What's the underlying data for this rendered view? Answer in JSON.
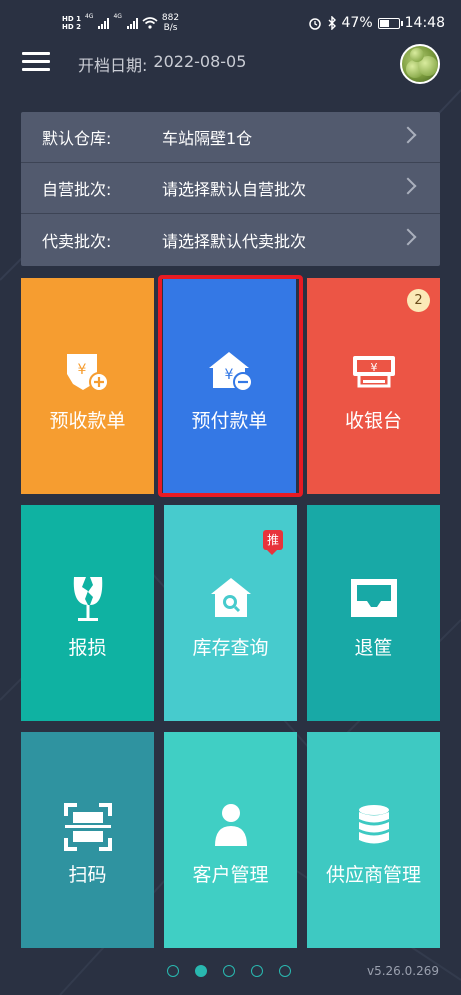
{
  "status_bar": {
    "hd1": "HD 1",
    "hd2": "HD 2",
    "net1": "4G",
    "net2": "4G",
    "speed_value": "882",
    "speed_unit": "B/s",
    "battery": "47%",
    "time": "14:48"
  },
  "header": {
    "date_label": "开档日期:",
    "date_value": "2022-08-05"
  },
  "settings": [
    {
      "label": "默认仓库:",
      "value": "车站隔壁1仓"
    },
    {
      "label": "自营批次:",
      "value": "请选择默认自营批次"
    },
    {
      "label": "代卖批次:",
      "value": "请选择默认代卖批次"
    }
  ],
  "tiles": [
    {
      "label": "预收款单",
      "color": "#f69d30",
      "icon": "receipt-add-icon"
    },
    {
      "label": "预付款单",
      "color": "#3478e5",
      "icon": "house-yen-icon"
    },
    {
      "label": "收银台",
      "color": "#ec5545",
      "icon": "cashier-icon",
      "badge": "2"
    },
    {
      "label": "报损",
      "color": "#0fb2a2",
      "icon": "broken-glass-icon"
    },
    {
      "label": "库存查询",
      "color": "#47cbcd",
      "icon": "warehouse-search-icon",
      "tag": "推"
    },
    {
      "label": "退筐",
      "color": "#18a9a6",
      "icon": "tray-icon"
    },
    {
      "label": "扫码",
      "color": "#2f93a0",
      "icon": "scan-icon"
    },
    {
      "label": "客户管理",
      "color": "#40cfc4",
      "icon": "person-icon"
    },
    {
      "label": "供应商管理",
      "color": "#3ec9c2",
      "icon": "database-icon"
    }
  ],
  "pagination": {
    "count": 5,
    "active": 2
  },
  "version": "v5.26.0.269"
}
